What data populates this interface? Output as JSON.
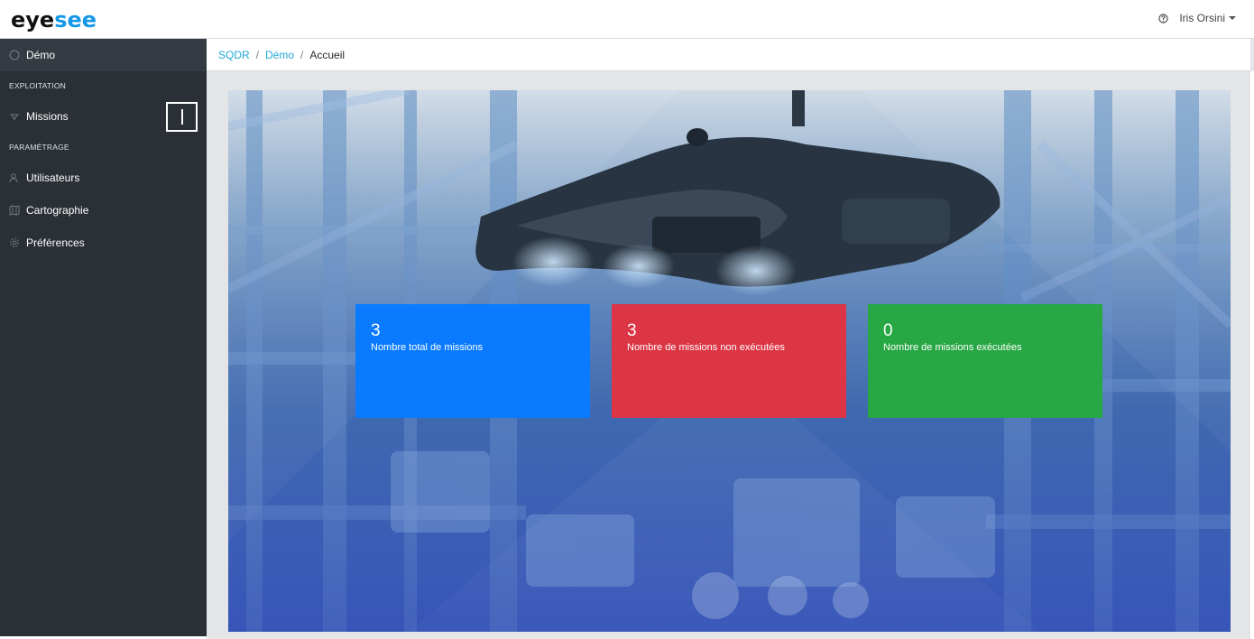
{
  "app": {
    "logo_part1": "eye",
    "logo_part2": "see"
  },
  "header": {
    "help_icon": "help-circle-icon",
    "user_name": "Iris Orsini"
  },
  "sidebar": {
    "project": {
      "label": "Démo",
      "icon": "circle-icon"
    },
    "sections": [
      {
        "title": "EXPLOITATION",
        "items": [
          {
            "label": "Missions",
            "icon": "drone-icon"
          }
        ]
      },
      {
        "title": "PARAMÉTRAGE",
        "items": [
          {
            "label": "Utilisateurs",
            "icon": "users-icon"
          },
          {
            "label": "Cartographie",
            "icon": "map-icon"
          },
          {
            "label": "Préférences",
            "icon": "gear-icon"
          }
        ]
      }
    ]
  },
  "breadcrumb": [
    "SQDR",
    "Démo",
    "Accueil"
  ],
  "stats": [
    {
      "value": "3",
      "label": "Nombre total de missions",
      "color": "#0a7bff"
    },
    {
      "value": "3",
      "label": "Nombre de missions non exécutées",
      "color": "#dc3545"
    },
    {
      "value": "0",
      "label": "Nombre de missions exécutées",
      "color": "#28a745"
    }
  ]
}
